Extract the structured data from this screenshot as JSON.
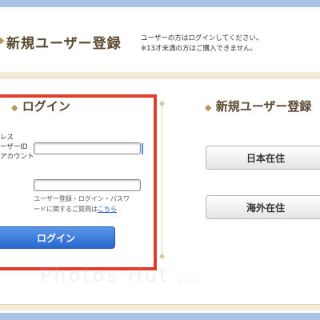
{
  "header": {
    "title": "新規ユーザー登録",
    "note_line1": "ユーザーの方はログインしてください。",
    "note_line2": "※13才未満の方はご購入できません。"
  },
  "login": {
    "heading": "ログイン",
    "heading_deco": "◆",
    "label_line1": "レス",
    "label_line2": "ーザーID",
    "label_line3": "アカウント",
    "username_value": "",
    "password_value": "",
    "help_line1": "ユーザー登録・ログイン・パスワ",
    "help_line2_prefix": "ードに関するご質問は",
    "help_link": "こちら",
    "button_label": "ログイン"
  },
  "register": {
    "heading": "新規ユーザー登録",
    "heading_deco": "◆",
    "japan_button": "日本在住",
    "overseas_button": "海外在住"
  },
  "watermark": "Photos Hut ...",
  "colors": {
    "accent_blue": "#2767d1",
    "highlight_red": "#e13b2b",
    "heading_brown": "#5a4a32",
    "gold": "#b8975a"
  }
}
